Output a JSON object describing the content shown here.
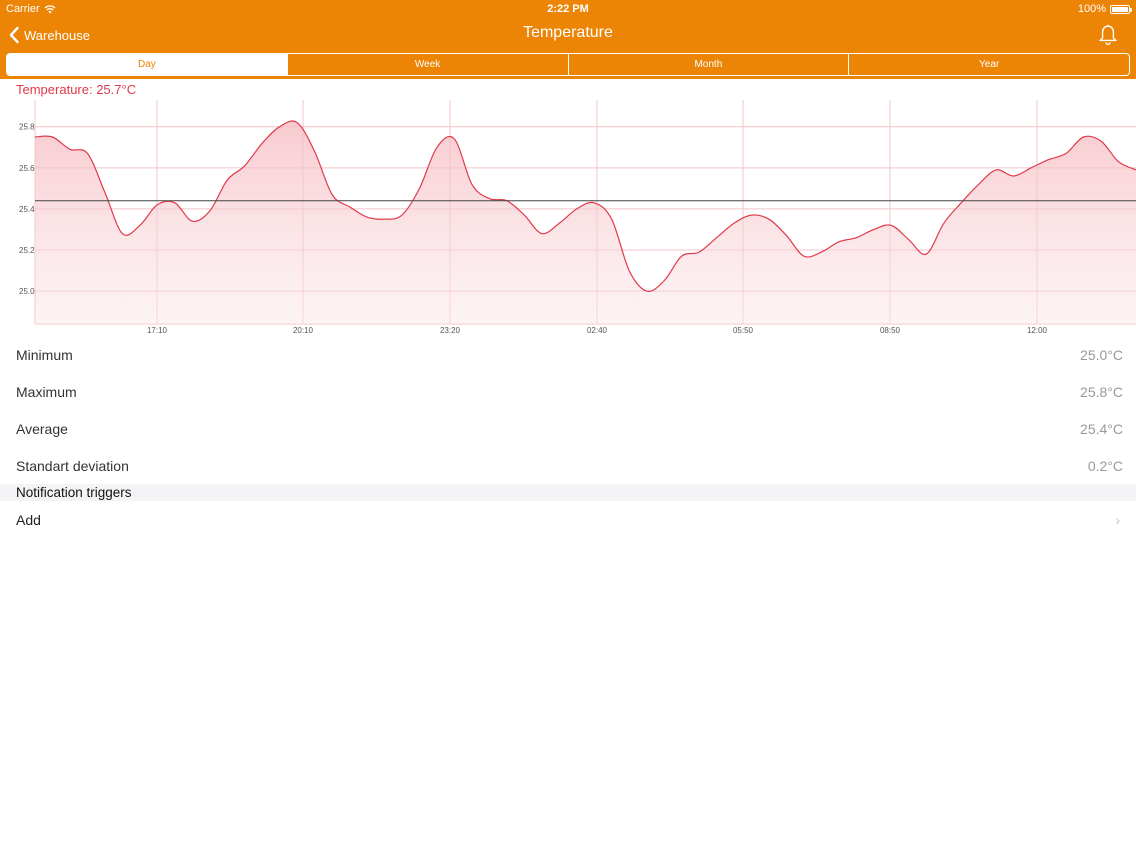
{
  "status_bar": {
    "carrier": "Carrier",
    "time": "2:22 PM",
    "battery": "100%"
  },
  "nav": {
    "back_label": "Warehouse",
    "title": "Temperature",
    "bell_icon": "bell-icon"
  },
  "tabs": [
    {
      "label": "Day",
      "active": true
    },
    {
      "label": "Week",
      "active": false
    },
    {
      "label": "Month",
      "active": false
    },
    {
      "label": "Year",
      "active": false
    }
  ],
  "current_reading": "Temperature: 25.7°C",
  "colors": {
    "header": "#ec8506",
    "line": "#e03a4a",
    "fill": "#f9d7da",
    "average": "#444444"
  },
  "chart_data": {
    "type": "area",
    "title": "",
    "xlabel": "",
    "ylabel": "",
    "y_ticks": [
      "25.0",
      "25.2",
      "25.4",
      "25.6",
      "25.8"
    ],
    "x_ticks": [
      "17:10",
      "20:10",
      "23:20",
      "02:40",
      "05:50",
      "08:50",
      "12:00"
    ],
    "ylim": [
      24.84,
      25.93
    ],
    "average": 25.44,
    "series": [
      {
        "values": [
          25.75,
          25.75,
          25.69,
          25.67,
          25.48,
          25.28,
          25.32,
          25.42,
          25.43,
          25.34,
          25.39,
          25.54,
          25.61,
          25.72,
          25.8,
          25.82,
          25.68,
          25.47,
          25.41,
          25.36,
          25.35,
          25.37,
          25.5,
          25.7,
          25.74,
          25.52,
          25.45,
          25.44,
          25.37,
          25.28,
          25.33,
          25.4,
          25.43,
          25.35,
          25.1,
          25.0,
          25.05,
          25.17,
          25.19,
          25.26,
          25.33,
          25.37,
          25.35,
          25.27,
          25.17,
          25.19,
          25.24,
          25.26,
          25.3,
          25.32,
          25.25,
          25.18,
          25.33,
          25.43,
          25.52,
          25.59,
          25.56,
          25.6,
          25.64,
          25.67,
          25.75,
          25.73,
          25.63,
          25.59
        ]
      }
    ]
  },
  "stats": [
    {
      "label": "Minimum",
      "value": "25.0°C"
    },
    {
      "label": "Maximum",
      "value": "25.8°C"
    },
    {
      "label": "Average",
      "value": "25.4°C"
    },
    {
      "label": "Standart deviation",
      "value": "0.2°C"
    }
  ],
  "notifications": {
    "section_title": "Notification triggers",
    "add_label": "Add"
  }
}
